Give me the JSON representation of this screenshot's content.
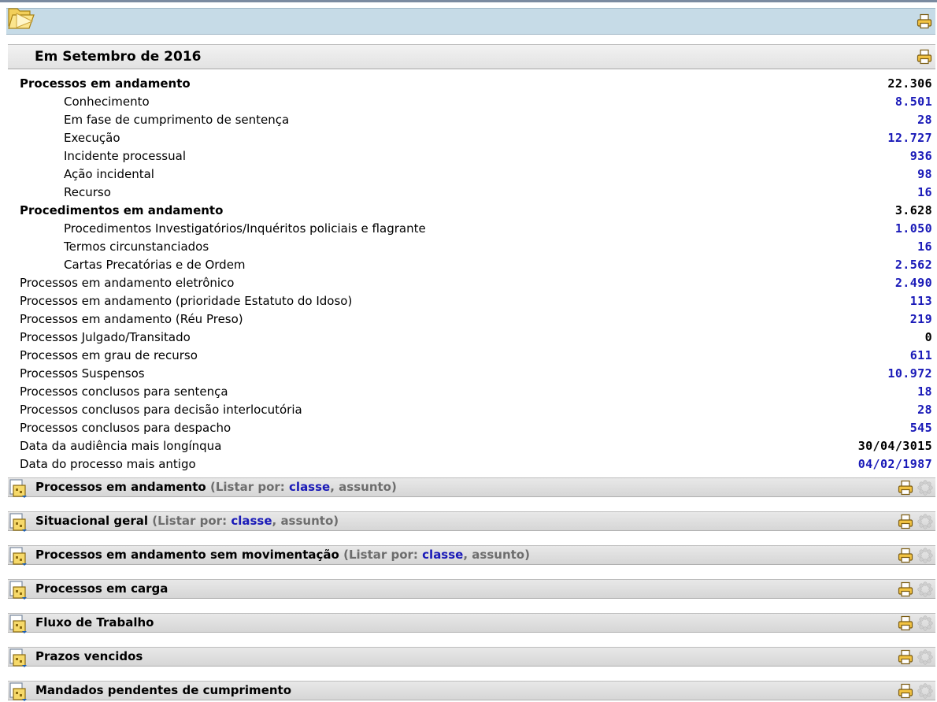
{
  "header": {
    "month_title": "Em Setembro de 2016"
  },
  "stats": [
    {
      "label": "Processos em andamento",
      "value": "22.306",
      "style": "bold"
    },
    {
      "label": "Conhecimento",
      "value": "8.501",
      "style": "indent"
    },
    {
      "label": "Em fase de cumprimento de sentença",
      "value": "28",
      "style": "indent"
    },
    {
      "label": "Execução",
      "value": "12.727",
      "style": "indent"
    },
    {
      "label": "Incidente processual",
      "value": "936",
      "style": "indent"
    },
    {
      "label": "Ação incidental",
      "value": "98",
      "style": "indent"
    },
    {
      "label": "Recurso",
      "value": "16",
      "style": "indent"
    },
    {
      "label": "Procedimentos em andamento",
      "value": "3.628",
      "style": "bold"
    },
    {
      "label": "Procedimentos Investigatórios/Inquéritos policiais e flagrante",
      "value": "1.050",
      "style": "indent"
    },
    {
      "label": "Termos circunstanciados",
      "value": "16",
      "style": "indent"
    },
    {
      "label": "Cartas Precatórias e de Ordem",
      "value": "2.562",
      "style": "indent"
    },
    {
      "label": "Processos em andamento eletrônico",
      "value": "2.490",
      "style": "normal"
    },
    {
      "label": "Processos em andamento (prioridade Estatuto do Idoso)",
      "value": "113",
      "style": "normal"
    },
    {
      "label": "Processos em andamento (Réu Preso)",
      "value": "219",
      "style": "normal"
    },
    {
      "label": "Processos Julgado/Transitado",
      "value": "0",
      "style": "normal",
      "plain": true
    },
    {
      "label": "Processos em grau de recurso",
      "value": "611",
      "style": "normal"
    },
    {
      "label": "Processos Suspensos",
      "value": "10.972",
      "style": "normal"
    },
    {
      "label": "Processos conclusos para sentença",
      "value": "18",
      "style": "normal"
    },
    {
      "label": "Processos conclusos para decisão interlocutória",
      "value": "28",
      "style": "normal"
    },
    {
      "label": "Processos conclusos para despacho",
      "value": "545",
      "style": "normal"
    },
    {
      "label": "Data da audiência mais longínqua",
      "value": "30/04/3015",
      "style": "normal",
      "plain": true
    },
    {
      "label": "Data do processo mais antigo",
      "value": "04/02/1987",
      "style": "normal"
    }
  ],
  "sections": [
    {
      "title": "Processos em andamento",
      "list_by": true
    },
    {
      "title": "Situacional geral",
      "list_by": true
    },
    {
      "title": "Processos em andamento sem movimentação",
      "list_by": true
    },
    {
      "title": "Processos em carga",
      "list_by": false
    },
    {
      "title": "Fluxo de Trabalho",
      "list_by": false
    },
    {
      "title": "Prazos vencidos",
      "list_by": false
    },
    {
      "title": "Mandados pendentes de cumprimento",
      "list_by": false
    }
  ],
  "list_by": {
    "open": "(",
    "prefix": "Listar por:",
    "classe": "classe",
    "sep": ",",
    "assunto": "assunto",
    "close": ")"
  },
  "colors": {
    "link": "#1a1ab8",
    "topbar": "#c6dbe7",
    "section_bg": "#dcdcdc"
  }
}
